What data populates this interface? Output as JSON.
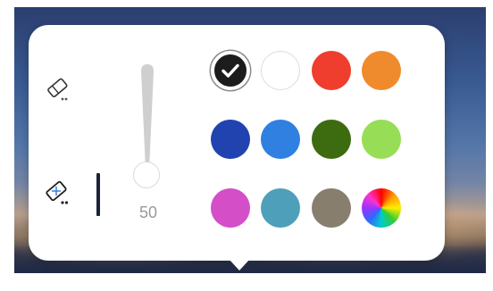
{
  "toolbar": {
    "tools": [
      {
        "name": "eraser",
        "icon": "eraser-icon"
      },
      {
        "name": "area-eraser",
        "icon": "area-eraser-icon"
      }
    ],
    "stroke_size": {
      "value": "50",
      "level": 0.5
    }
  },
  "palette": {
    "selected_index": 0,
    "colors": [
      {
        "name": "black",
        "hex": "#1c1c1c"
      },
      {
        "name": "white",
        "hex": "#ffffff"
      },
      {
        "name": "red",
        "hex": "#ef3e2d"
      },
      {
        "name": "orange",
        "hex": "#ef8b2c"
      },
      {
        "name": "dark-blue",
        "hex": "#2043b0"
      },
      {
        "name": "blue",
        "hex": "#2f80e0"
      },
      {
        "name": "dark-green",
        "hex": "#3d6b10"
      },
      {
        "name": "light-green",
        "hex": "#97dd55"
      },
      {
        "name": "magenta",
        "hex": "#d44ec8"
      },
      {
        "name": "teal",
        "hex": "#4e9fba"
      },
      {
        "name": "taupe",
        "hex": "#877e6e"
      },
      {
        "name": "custom-color",
        "hex": "rainbow"
      }
    ]
  }
}
